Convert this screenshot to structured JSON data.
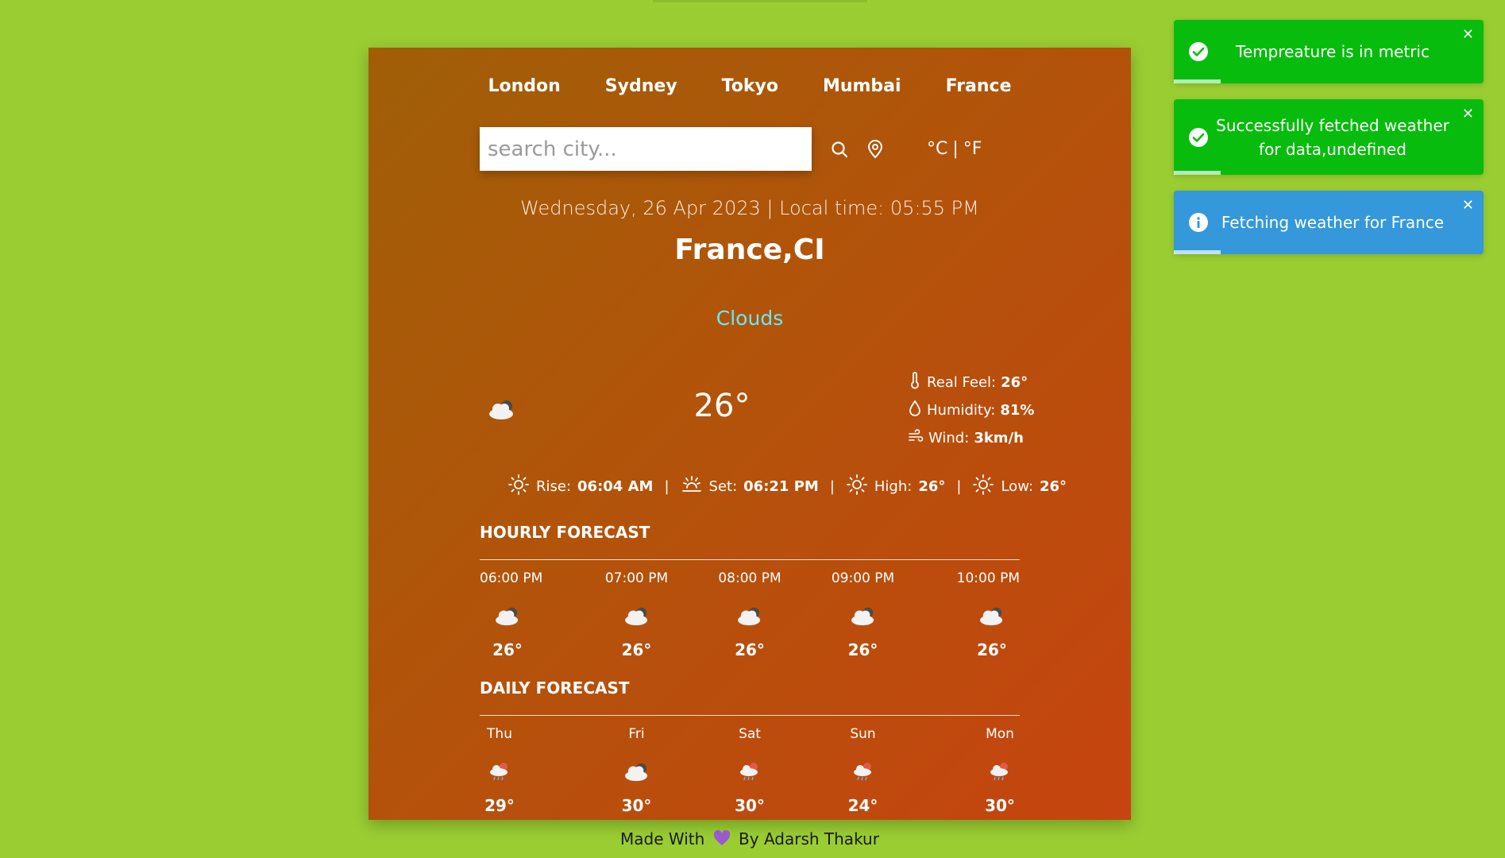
{
  "cities": [
    "London",
    "Sydney",
    "Tokyo",
    "Mumbai",
    "France"
  ],
  "search": {
    "placeholder": "search city..."
  },
  "icons": {
    "search": "search-icon",
    "location": "location-pin-icon",
    "thermometer": "thermometer-icon",
    "humidity": "droplet-icon",
    "wind": "wind-icon",
    "sunrise": "sun-icon",
    "sunset": "sunset-icon",
    "cloud": "cloud-icon",
    "rain": "rain-cloud-icon",
    "check": "check-circle-icon",
    "info": "info-circle-icon",
    "close": "close-icon",
    "heart": "heart-icon"
  },
  "units": {
    "celsius": "°C",
    "separator": "|",
    "fahrenheit": "°F"
  },
  "date_line": "Wednesday, 26 Apr 2023 | Local time: 05:55 PM",
  "location": "France,CI",
  "condition": "Clouds",
  "temperature": "26°",
  "details": {
    "real_feel_label": "Real Feel:",
    "real_feel": "26°",
    "humidity_label": "Humidity:",
    "humidity": "81%",
    "wind_label": "Wind:",
    "wind": "3km/h"
  },
  "sun": {
    "rise_label": "Rise:",
    "rise": "06:04 AM",
    "set_label": "Set:",
    "set": "06:21 PM",
    "high_label": "High:",
    "high": "26°",
    "low_label": "Low:",
    "low": "26°",
    "separator": "|"
  },
  "hourly": {
    "title": "HOURLY FORECAST",
    "items": [
      {
        "label": "06:00 PM",
        "temp": "26°"
      },
      {
        "label": "07:00 PM",
        "temp": "26°"
      },
      {
        "label": "08:00 PM",
        "temp": "26°"
      },
      {
        "label": "09:00 PM",
        "temp": "26°"
      },
      {
        "label": "10:00 PM",
        "temp": "26°"
      }
    ]
  },
  "daily": {
    "title": "DAILY FORECAST",
    "items": [
      {
        "label": "Thu",
        "temp": "29°"
      },
      {
        "label": "Fri",
        "temp": "30°"
      },
      {
        "label": "Sat",
        "temp": "30°"
      },
      {
        "label": "Sun",
        "temp": "24°"
      },
      {
        "label": "Mon",
        "temp": "30°"
      }
    ]
  },
  "footer": {
    "made_with": "Made With",
    "by": "By Adarsh Thakur"
  },
  "toasts": [
    {
      "type": "success",
      "message": "Tempreature is in metric",
      "close": "✕",
      "progress": 0.15
    },
    {
      "type": "success",
      "message": "Successfully fetched weather for data,undefined",
      "close": "✕",
      "progress": 0.15
    },
    {
      "type": "info",
      "message": "Fetching weather for France",
      "close": "✕",
      "progress": 0.15
    }
  ],
  "colors": {
    "background": "#9acd32",
    "card_start": "#a05f07",
    "card_end": "#c6440f",
    "condition": "#67e8f9",
    "toast_success": "#07bc0c",
    "toast_info": "#3498db",
    "heart": "#9b59d0"
  }
}
